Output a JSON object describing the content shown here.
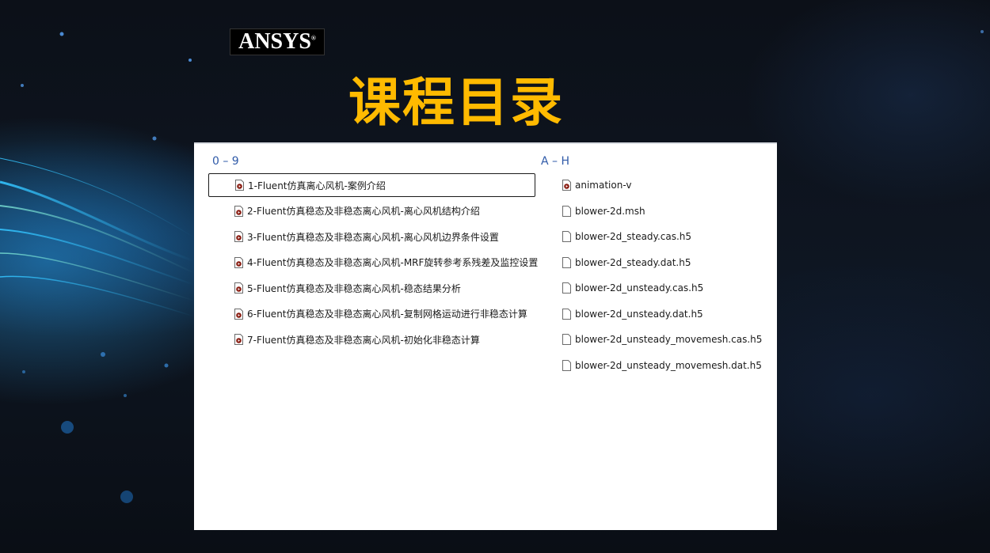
{
  "logo": {
    "text_main": "ANSYS",
    "registered": "®"
  },
  "title": "课程目录",
  "groups": [
    {
      "header": "0 – 9",
      "items": [
        {
          "label": "1-Fluent仿真离心风机-案例介绍",
          "icon": "video-file-icon",
          "selected": true
        },
        {
          "label": "2-Fluent仿真稳态及非稳态离心风机-离心风机结构介绍",
          "icon": "video-file-icon"
        },
        {
          "label": "3-Fluent仿真稳态及非稳态离心风机-离心风机边界条件设置",
          "icon": "video-file-icon"
        },
        {
          "label": "4-Fluent仿真稳态及非稳态离心风机-MRF旋转参考系残差及监控设置",
          "icon": "video-file-icon"
        },
        {
          "label": "5-Fluent仿真稳态及非稳态离心风机-稳态结果分析",
          "icon": "video-file-icon"
        },
        {
          "label": "6-Fluent仿真稳态及非稳态离心风机-复制网格运动进行非稳态计算",
          "icon": "video-file-icon"
        },
        {
          "label": "7-Fluent仿真稳态及非稳态离心风机-初始化非稳态计算",
          "icon": "video-file-icon"
        }
      ]
    },
    {
      "header": "A – H",
      "items": [
        {
          "label": "animation-v",
          "icon": "video-file-icon"
        },
        {
          "label": "blower-2d.msh",
          "icon": "blank-file-icon"
        },
        {
          "label": "blower-2d_steady.cas.h5",
          "icon": "blank-file-icon"
        },
        {
          "label": "blower-2d_steady.dat.h5",
          "icon": "blank-file-icon"
        },
        {
          "label": "blower-2d_unsteady.cas.h5",
          "icon": "blank-file-icon"
        },
        {
          "label": "blower-2d_unsteady.dat.h5",
          "icon": "blank-file-icon"
        },
        {
          "label": "blower-2d_unsteady_movemesh.cas.h5",
          "icon": "blank-file-icon"
        },
        {
          "label": "blower-2d_unsteady_movemesh.dat.h5",
          "icon": "blank-file-icon"
        }
      ]
    }
  ],
  "colors": {
    "title": "#ffba00",
    "group_header": "#2f5aa8",
    "logo_accent": "#ffb81c"
  }
}
